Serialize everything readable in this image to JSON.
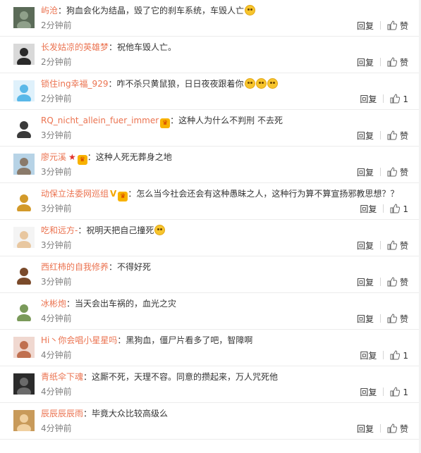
{
  "comments": [
    {
      "user": "屿沧",
      "text": "狗血会化为结晶，毁了它的刹车系统，车毁人亡",
      "emojis": 1,
      "time": "2分钟前",
      "reply": "回复",
      "like": "赞"
    },
    {
      "user": "长发姑凉的英雄梦",
      "text": "祝他车毁人亡。",
      "emojis": 0,
      "time": "2分钟前",
      "reply": "回复",
      "like": "赞"
    },
    {
      "user": "锁住ing幸福_929",
      "text": "咋不杀只黄鼠狼，日日夜夜跟着你",
      "emojis": 3,
      "time": "2分钟前",
      "reply": "回复",
      "like": "1"
    },
    {
      "user": "RQ_nicht_allein_fuer_immer",
      "badge": true,
      "text": "这种人为什么不判刑 不去死",
      "emojis": 0,
      "time": "3分钟前",
      "reply": "回复",
      "like": "赞"
    },
    {
      "user": "廖元溪",
      "star": true,
      "badge": true,
      "text": "这种人死无葬身之地",
      "emojis": 0,
      "time": "3分钟前",
      "reply": "回复",
      "like": "赞"
    },
    {
      "user": "动保立法委网巡组",
      "vmark": "V",
      "badge": true,
      "text": "怎么当今社会还会有这种愚昧之人，这种行为算不算宣扬邪教思想？？",
      "emojis": 0,
      "time": "3分钟前",
      "reply": "回复",
      "like": "1"
    },
    {
      "user": "吃和远方-",
      "text": "祝明天把自己撞死",
      "emojis": 1,
      "time": "3分钟前",
      "reply": "回复",
      "like": "赞"
    },
    {
      "user": "西红柿的自我修养",
      "text": "不得好死",
      "emojis": 0,
      "time": "3分钟前",
      "reply": "回复",
      "like": "赞"
    },
    {
      "user": "冰彬炮",
      "text": "当天会出车祸的，血光之灾",
      "emojis": 0,
      "time": "4分钟前",
      "reply": "回复",
      "like": "赞"
    },
    {
      "user": "Hi丶你会唱小星星吗",
      "text": "黑狗血，僵尸片看多了吧，智障啊",
      "emojis": 0,
      "time": "4分钟前",
      "reply": "回复",
      "like": "1"
    },
    {
      "user": "青纸伞下魂",
      "text": "这厮不死，天理不容。同意的攒起来，万人咒死他",
      "emojis": 0,
      "time": "4分钟前",
      "reply": "回复",
      "like": "1"
    },
    {
      "user": "辰辰辰辰雨",
      "text": "毕竟大众比较高级么",
      "emojis": 0,
      "time": "4分钟前",
      "reply": "回复",
      "like": "赞"
    }
  ],
  "colors": {
    "username": "#eb7350",
    "time": "#808080",
    "text": "#333333"
  },
  "icons": {
    "like": "thumbs-up-icon",
    "emoji": "smiley-emoji-icon",
    "badge": "member-badge-icon"
  }
}
